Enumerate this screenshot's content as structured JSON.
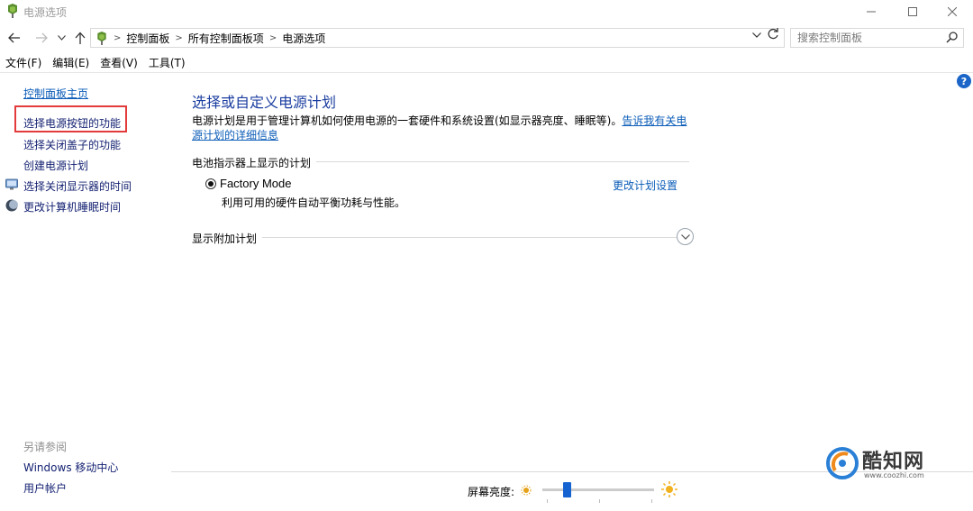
{
  "window": {
    "title": "电源选项"
  },
  "address": {
    "crumbs": [
      "控制面板",
      "所有控制面板项",
      "电源选项"
    ],
    "search_placeholder": "搜索控制面板"
  },
  "menu": [
    "文件(F)",
    "编辑(E)",
    "查看(V)",
    "工具(T)"
  ],
  "sidebar": {
    "home": "控制面板主页",
    "tasks": [
      {
        "label": "选择电源按钮的功能",
        "icon": "none",
        "highlighted": true
      },
      {
        "label": "选择关闭盖子的功能",
        "icon": "none"
      },
      {
        "label": "创建电源计划",
        "icon": "none"
      },
      {
        "label": "选择关闭显示器的时间",
        "icon": "monitor-icon"
      },
      {
        "label": "更改计算机睡眠时间",
        "icon": "moon-icon"
      }
    ],
    "see_also_title": "另请参阅",
    "see_also": [
      "Windows 移动中心",
      "用户帐户"
    ]
  },
  "main": {
    "title": "选择或自定义电源计划",
    "description": "电源计划是用于管理计算机如何使用电源的一套硬件和系统设置(如显示器亮度、睡眠等)。",
    "description_link": "告诉我有关电源计划的详细信息",
    "battery_group_label": "电池指示器上显示的计划",
    "plan": {
      "name": "Factory Mode",
      "selected": true,
      "description": "利用可用的硬件自动平衡功耗与性能。",
      "change_link": "更改计划设置"
    },
    "additional_group_label": "显示附加计划"
  },
  "brightness": {
    "label": "屏幕亮度:",
    "value_fraction": 0.22
  },
  "watermark": {
    "brand": "酷知网",
    "url": "www.coozhi.com"
  },
  "colors": {
    "accent": "#1563d1",
    "link": "#0b5cb8",
    "heading": "#1b3ea0",
    "highlight_box": "#e33b3b"
  }
}
